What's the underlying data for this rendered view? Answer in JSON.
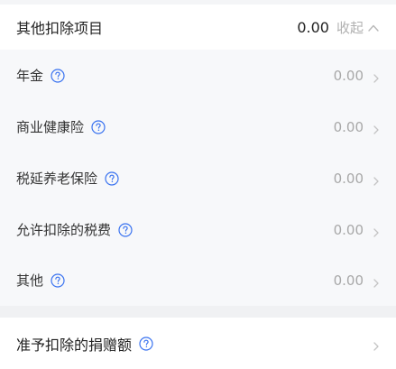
{
  "header": {
    "title": "其他扣除项目",
    "amount": "0.00",
    "collapse_label": "收起"
  },
  "items": [
    {
      "label": "年金",
      "value": "0.00"
    },
    {
      "label": "商业健康险",
      "value": "0.00"
    },
    {
      "label": "税延养老保险",
      "value": "0.00"
    },
    {
      "label": "允许扣除的税费",
      "value": "0.00"
    },
    {
      "label": "其他",
      "value": "0.00"
    }
  ],
  "donation": {
    "label": "准予扣除的捐赠额"
  },
  "colors": {
    "help_icon": "#3a73f0",
    "value_text": "#a8a8a8",
    "chevron": "#c4c4c4"
  }
}
